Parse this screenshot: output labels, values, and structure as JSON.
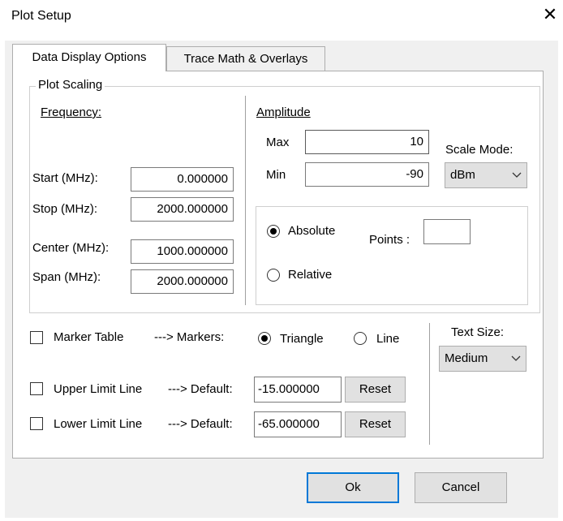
{
  "window": {
    "title": "Plot Setup",
    "close_glyph": "✕"
  },
  "tabs": [
    {
      "label": "Data Display Options",
      "active": true
    },
    {
      "label": "Trace Math & Overlays",
      "active": false
    }
  ],
  "plot_scaling": {
    "group_label": "Plot Scaling",
    "frequency": {
      "heading": "Frequency:",
      "start_label": "Start (MHz):",
      "start_value": "0.000000",
      "stop_label": "Stop (MHz):",
      "stop_value": "2000.000000",
      "center_label": "Center (MHz):",
      "center_value": "1000.000000",
      "span_label": "Span (MHz):",
      "span_value": "2000.000000"
    },
    "amplitude": {
      "heading": "Amplitude",
      "max_label": "Max",
      "max_value": "10",
      "min_label": "Min",
      "min_value": "-90",
      "scale_mode_label": "Scale Mode:",
      "scale_mode_value": "dBm",
      "absolute_label": "Absolute",
      "relative_label": "Relative",
      "selected_mode": "Absolute",
      "points_label": "Points :",
      "points_value": ""
    }
  },
  "markers": {
    "marker_table_label": "Marker Table",
    "marker_table_checked": false,
    "markers_arrow_label": "---> Markers:",
    "triangle_label": "Triangle",
    "line_label": "Line",
    "selected_marker": "Triangle"
  },
  "limits": {
    "upper_label": "Upper Limit Line",
    "upper_checked": false,
    "upper_default_label": "---> Default:",
    "upper_value": "-15.000000",
    "lower_label": "Lower Limit Line",
    "lower_checked": false,
    "lower_default_label": "---> Default:",
    "lower_value": "-65.000000",
    "reset_label": "Reset"
  },
  "text_size": {
    "label": "Text Size:",
    "value": "Medium"
  },
  "footer": {
    "ok_label": "Ok",
    "cancel_label": "Cancel"
  },
  "icons": {
    "dropdown": "chevron-down-icon",
    "close": "close-icon"
  },
  "colors": {
    "panel": "#ffffff",
    "dialog_bg": "#f0f0f0",
    "focus_border": "#0078d7",
    "button": "#e1e1e1"
  }
}
